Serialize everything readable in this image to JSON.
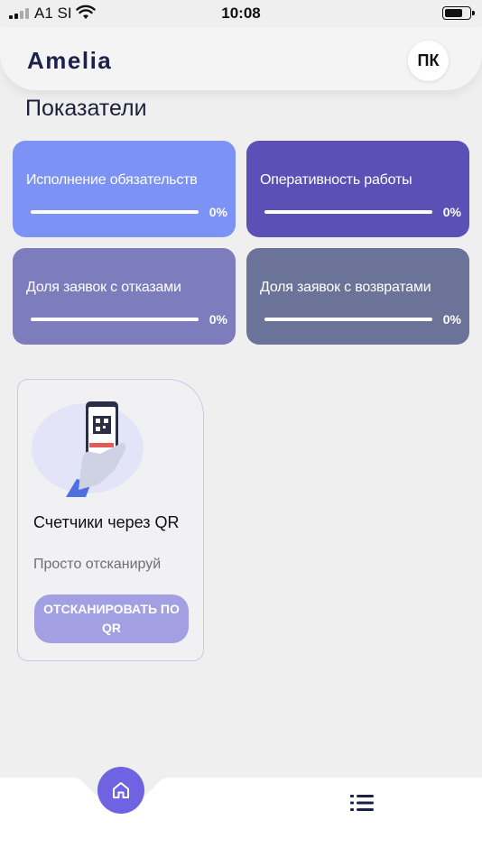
{
  "status_bar": {
    "carrier": "A1 SI",
    "time": "10:08",
    "battery_level": 0.75
  },
  "header": {
    "logo": "Amelia",
    "avatar_initials": "ПК"
  },
  "section_title": "Показатели",
  "metrics": [
    {
      "label": "Исполнение обязательств",
      "value_text": "0%",
      "progress": 0,
      "color": "#7c92f5"
    },
    {
      "label": "Оперативность работы",
      "value_text": "0%",
      "progress": 0,
      "color": "#5a50b6"
    },
    {
      "label": "Доля заявок с отказами",
      "value_text": "0%",
      "progress": 0,
      "color": "#7d7cbc"
    },
    {
      "label": "Доля заявок с возвратами",
      "value_text": "0%",
      "progress": 0,
      "color": "#6c7399"
    }
  ],
  "qr_card": {
    "title": "Счетчики через QR",
    "subtitle": "Просто отсканируй",
    "button_label": "ОТСКАНИРОВАТЬ ПО QR"
  },
  "bottom_nav": {
    "items": [
      {
        "icon": "home-icon",
        "active": true
      },
      {
        "icon": "list-icon",
        "active": false
      }
    ],
    "accent": "#6f63e2"
  }
}
